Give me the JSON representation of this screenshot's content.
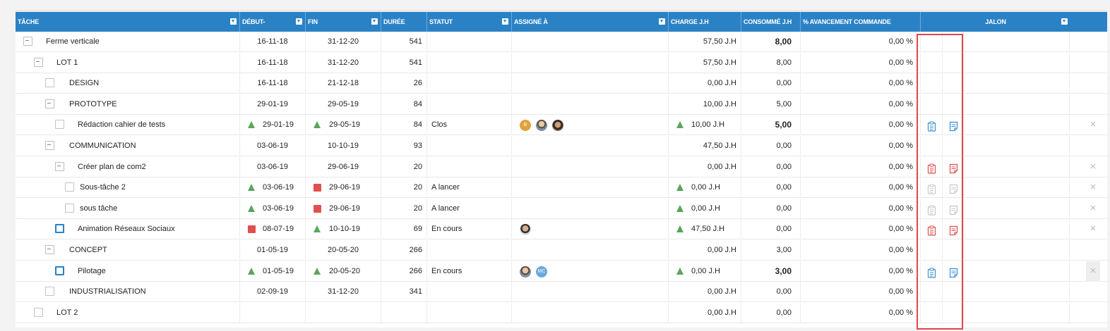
{
  "headers": [
    {
      "label": "TÂCHE",
      "filter": true
    },
    {
      "label": "DÉBUT-",
      "filter": true
    },
    {
      "label": "FIN",
      "filter": true
    },
    {
      "label": "DURÉE",
      "filter": false
    },
    {
      "label": "STATUT",
      "filter": true
    },
    {
      "label": "ASSIGNÉ À",
      "filter": true
    },
    {
      "label": "CHARGE J.H",
      "filter": false
    },
    {
      "label": "CONSOMMÉ J.H",
      "filter": false
    },
    {
      "label": "% AVANCEMENT COMMANDE",
      "filter": false
    },
    {
      "label": "JALON",
      "filter": true
    }
  ],
  "colors": {
    "header": "#2a82c5",
    "green": "#5aa55a",
    "red": "#e14f4f",
    "blue_icon": "#3b8fd6",
    "red_icon": "#e14f4f",
    "grey_icon": "#c8c8c8",
    "highlight": "#e04848"
  },
  "rows": [
    {
      "level": 0,
      "control": "minus",
      "name": "Ferme verticale",
      "debut": "16-11-18",
      "fin": "31-12-20",
      "duree": "541",
      "statut": "",
      "charge": "57,50 J.H",
      "consomme": "8,00",
      "consomme_bold": true,
      "avancement": "0,00 %",
      "icons": null,
      "x": false
    },
    {
      "level": 1,
      "control": "minus",
      "name": "LOT 1",
      "debut": "16-11-18",
      "fin": "31-12-20",
      "duree": "541",
      "statut": "",
      "charge": "57,50 J.H",
      "consomme": "8,00",
      "avancement": "0,00 %",
      "icons": null,
      "x": false
    },
    {
      "level": 2,
      "control": "box",
      "name": "DESIGN",
      "debut": "16-11-18",
      "fin": "21-12-18",
      "duree": "26",
      "statut": "",
      "charge": "0,00 J.H",
      "consomme": "0,00",
      "avancement": "0,00 %",
      "icons": null,
      "x": false
    },
    {
      "level": 2,
      "control": "minus",
      "name": "PROTOTYPE",
      "debut": "29-01-19",
      "fin": "29-05-19",
      "duree": "84",
      "statut": "",
      "charge": "10,00 J.H",
      "consomme": "5,00",
      "avancement": "0,00 %",
      "icons": null,
      "x": false
    },
    {
      "level": 3,
      "control": "box",
      "name": "Rédaction cahier de tests",
      "debut": "29-01-19",
      "debut_ind": "tri",
      "fin": "29-05-19",
      "fin_ind": "tri",
      "duree": "84",
      "statut": "Clos",
      "assignees": [
        "orange",
        "photo",
        "photo3"
      ],
      "orange_initials": "B",
      "charge": "10,00 J.H",
      "charge_ind": "tri",
      "consomme": "5,00",
      "consomme_bold": true,
      "avancement": "0,00 %",
      "icons": "blue",
      "x": true
    },
    {
      "level": 2,
      "control": "minus",
      "name": "COMMUNICATION",
      "debut": "03-06-19",
      "fin": "10-10-19",
      "duree": "93",
      "statut": "",
      "charge": "47,50 J.H",
      "consomme": "0,00",
      "avancement": "0,00 %",
      "icons": null,
      "x": false
    },
    {
      "level": 3,
      "control": "minus",
      "name": "Créer plan de com2",
      "debut": "03-06-19",
      "fin": "29-06-19",
      "duree": "20",
      "statut": "",
      "charge": "0,00 J.H",
      "consomme": "0,00",
      "avancement": "0,00 %",
      "icons": "red",
      "x": true
    },
    {
      "level": 4,
      "control": "box",
      "name": "Sous-tâche 2",
      "debut": "03-06-19",
      "debut_ind": "tri",
      "fin": "29-06-19",
      "fin_ind": "sq",
      "duree": "20",
      "statut": "A lancer",
      "charge": "0,00 J.H",
      "charge_ind": "tri",
      "consomme": "0,00",
      "avancement": "0,00 %",
      "icons": "grey",
      "x": true
    },
    {
      "level": 4,
      "control": "box",
      "name": "sous tâche",
      "debut": "03-06-19",
      "debut_ind": "tri",
      "fin": "29-06-19",
      "fin_ind": "sq",
      "duree": "20",
      "statut": "A lancer",
      "charge": "0,00 J.H",
      "charge_ind": "tri",
      "consomme": "0,00",
      "avancement": "0,00 %",
      "icons": "grey",
      "x": true
    },
    {
      "level": 3,
      "control": "bluebox",
      "name": "Animation Réseaux Sociaux",
      "debut": "08-07-19",
      "debut_ind": "sq",
      "fin": "10-10-19",
      "fin_ind": "tri",
      "duree": "69",
      "statut": "En cours",
      "assignees": [
        "photo2"
      ],
      "charge": "47,50 J.H",
      "charge_ind": "tri",
      "consomme": "0,00",
      "avancement": "0,00 %",
      "icons": "red",
      "x": true
    },
    {
      "level": 2,
      "control": "minus",
      "name": "CONCEPT",
      "debut": "01-05-19",
      "fin": "20-05-20",
      "duree": "266",
      "statut": "",
      "charge": "0,00 J.H",
      "consomme": "3,00",
      "avancement": "0,00 %",
      "icons": null,
      "x": false
    },
    {
      "level": 3,
      "control": "bluebox",
      "name": "Pilotage",
      "debut": "01-05-19",
      "debut_ind": "tri",
      "fin": "20-05-20",
      "fin_ind": "tri",
      "duree": "266",
      "statut": "En cours",
      "assignees": [
        "photo",
        "blue"
      ],
      "blue_initials": "MC",
      "charge": "0,00 J.H",
      "charge_ind": "tri",
      "consomme": "3,00",
      "consomme_bold": true,
      "avancement": "0,00 %",
      "icons": "blue",
      "x": true,
      "x_grey": true
    },
    {
      "level": 2,
      "control": "box",
      "name": "INDUSTRIALISATION",
      "debut": "02-09-19",
      "fin": "31-12-20",
      "duree": "341",
      "statut": "",
      "charge": "0,00 J.H",
      "consomme": "0,00",
      "avancement": "0,00 %",
      "icons": null,
      "x": false
    },
    {
      "level": 1,
      "control": "box",
      "name": "LOT 2",
      "debut": "",
      "fin": "",
      "duree": "",
      "statut": "",
      "charge": "0,00 J.H",
      "consomme": "0,00",
      "avancement": "0,00 %",
      "icons": null,
      "x": false
    }
  ]
}
